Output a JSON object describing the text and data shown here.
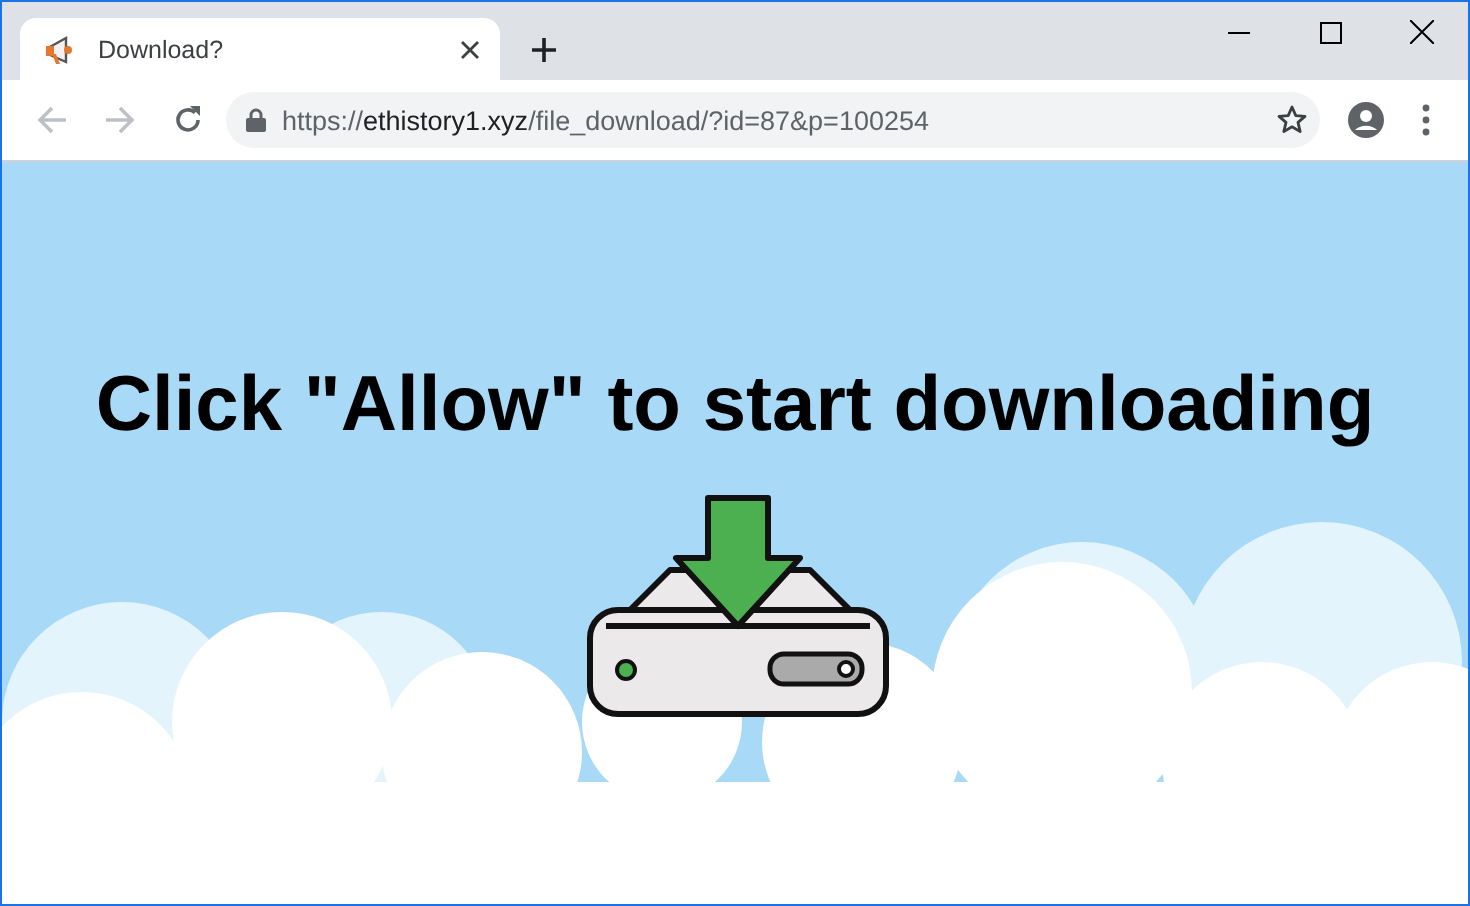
{
  "tab": {
    "title": "Download?",
    "selected": true
  },
  "address_bar": {
    "scheme": "https://",
    "host": "ethistory1.xyz",
    "path": "/file_download/?id=87&p=100254"
  },
  "page": {
    "headline": "Click \"Allow\" to start downloading"
  }
}
